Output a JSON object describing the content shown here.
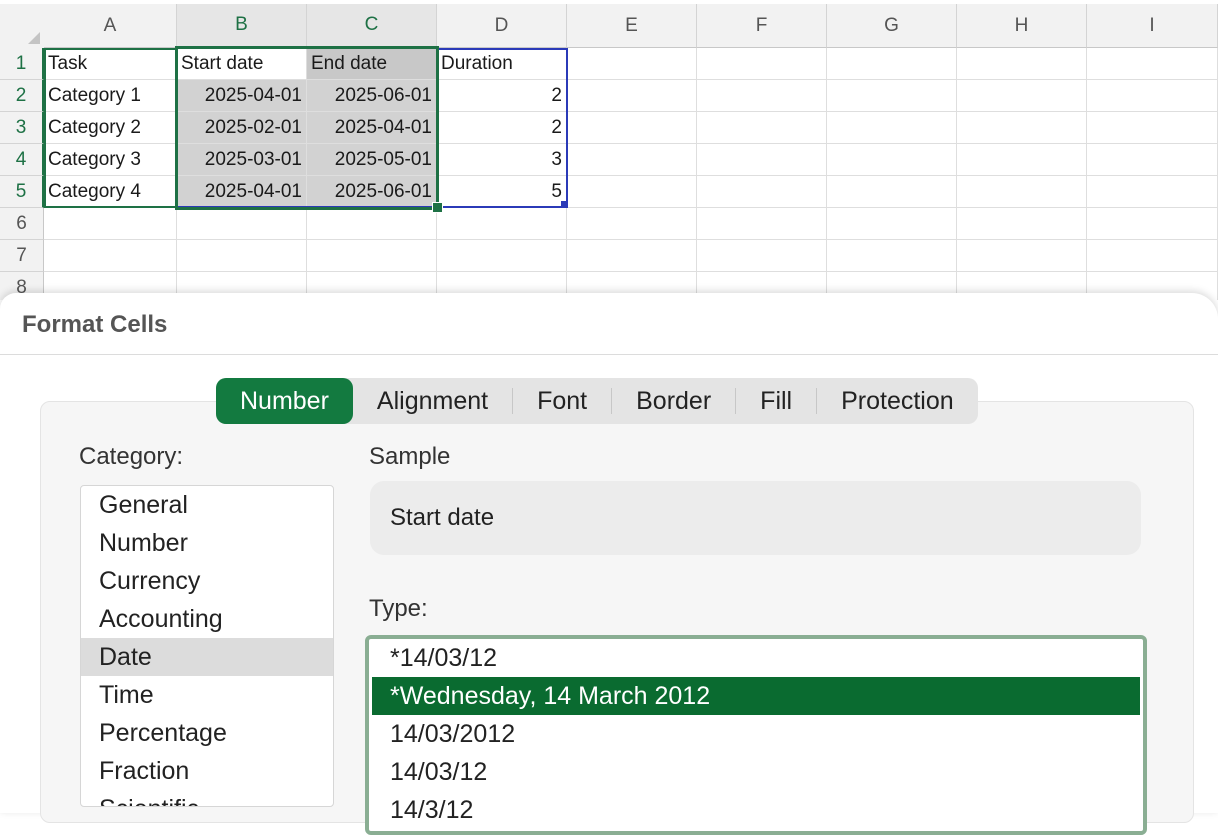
{
  "sheet": {
    "columns": [
      "A",
      "B",
      "C",
      "D",
      "E",
      "F",
      "G",
      "H",
      "I"
    ],
    "rows": [
      "1",
      "2",
      "3",
      "4",
      "5",
      "6",
      "7",
      "8"
    ],
    "cells": [
      [
        "Task",
        "Start date",
        "End date",
        "Duration"
      ],
      [
        "Category 1",
        "2025-04-01",
        "2025-06-01",
        "2"
      ],
      [
        "Category 2",
        "2025-02-01",
        "2025-04-01",
        "2"
      ],
      [
        "Category 3",
        "2025-03-01",
        "2025-05-01",
        "3"
      ],
      [
        "Category 4",
        "2025-04-01",
        "2025-06-01",
        "5"
      ]
    ],
    "accent_color": "#1e7145",
    "ref_color": "#2b3ab8"
  },
  "dialog": {
    "title": "Format Cells",
    "tabs": [
      "Number",
      "Alignment",
      "Font",
      "Border",
      "Fill",
      "Protection"
    ],
    "active_tab": "Number",
    "category_label": "Category:",
    "categories": [
      "General",
      "Number",
      "Currency",
      "Accounting",
      "Date",
      "Time",
      "Percentage",
      "Fraction",
      "Scientific"
    ],
    "selected_category": "Date",
    "sample_label": "Sample",
    "sample_value": "Start date",
    "type_label": "Type:",
    "types": [
      "*14/03/12",
      "*Wednesday, 14 March 2012",
      "14/03/2012",
      "14/03/12",
      "14/3/12"
    ],
    "selected_type": "*Wednesday, 14 March 2012",
    "accent_color": "#137a40"
  }
}
